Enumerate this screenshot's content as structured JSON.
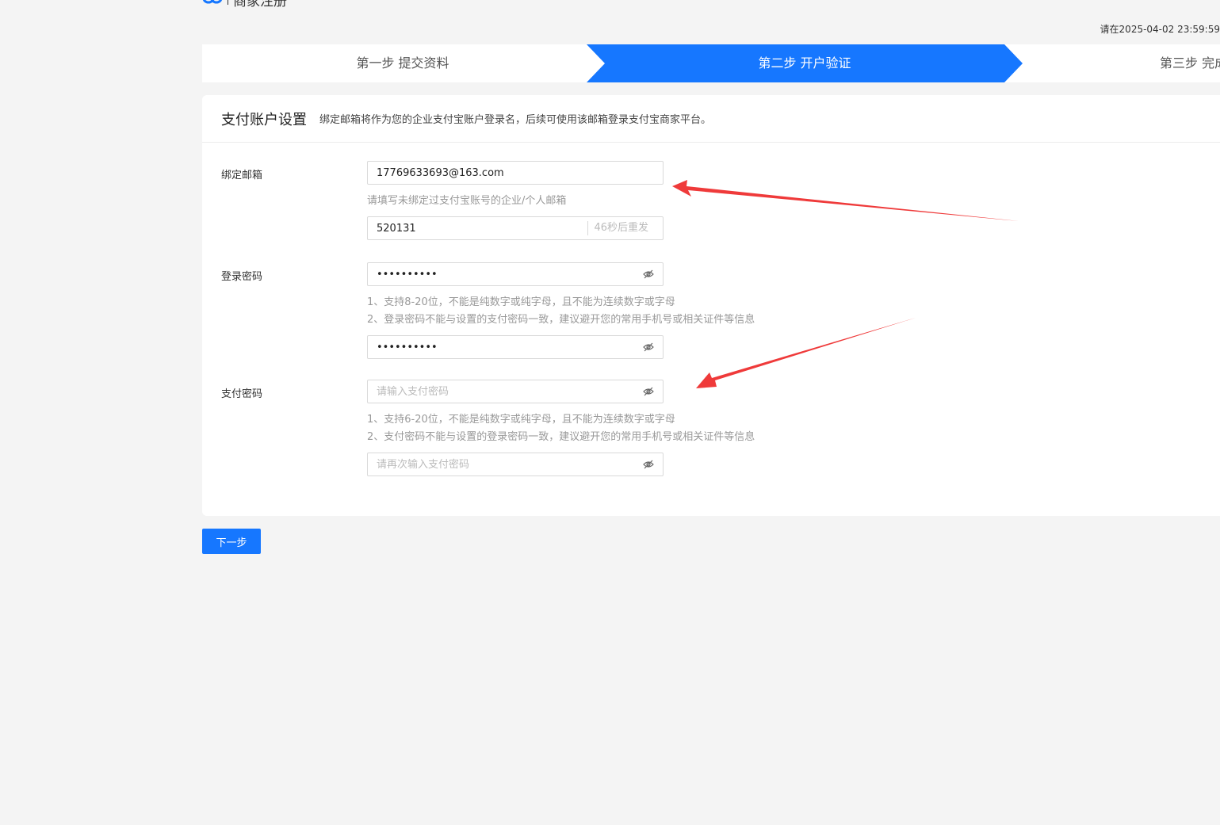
{
  "header": {
    "logo_title": "商家注册",
    "deadline": "请在2025-04-02 23:59:59"
  },
  "steps": [
    {
      "label": "第一步 提交资料",
      "active": false
    },
    {
      "label": "第二步 开户验证",
      "active": true
    },
    {
      "label": "第三步 完成"
    }
  ],
  "colors": {
    "accent": "#1677ff",
    "annotation": "#ef3a3a"
  },
  "card": {
    "title": "支付账户设置",
    "desc": "绑定邮箱将作为您的企业支付宝账户登录名，后续可使用该邮箱登录支付宝商家平台。"
  },
  "email": {
    "label": "绑定邮箱",
    "value": "17769633693@163.com",
    "hint": "请填写未绑定过支付宝账号的企业/个人邮箱",
    "code_value": "520131",
    "resend_label": "46秒后重发"
  },
  "login_password": {
    "label": "登录密码",
    "value": "••••••••••",
    "hint_1": "1、支持8-20位，不能是纯数字或纯字母，且不能为连续数字或字母",
    "hint_2": "2、登录密码不能与设置的支付密码一致，建议避开您的常用手机号或相关证件等信息",
    "confirm_value": "••••••••••"
  },
  "pay_password": {
    "label": "支付密码",
    "placeholder": "请输入支付密码",
    "hint_1": "1、支持6-20位，不能是纯数字或纯字母，且不能为连续数字或字母",
    "hint_2": "2、支付密码不能与设置的登录密码一致，建议避开您的常用手机号或相关证件等信息",
    "confirm_placeholder": "请再次输入支付密码"
  },
  "footer": {
    "next_label": "下一步"
  },
  "icons": {
    "eye": "eye-off-icon",
    "logo": "alipay-logo-icon"
  }
}
